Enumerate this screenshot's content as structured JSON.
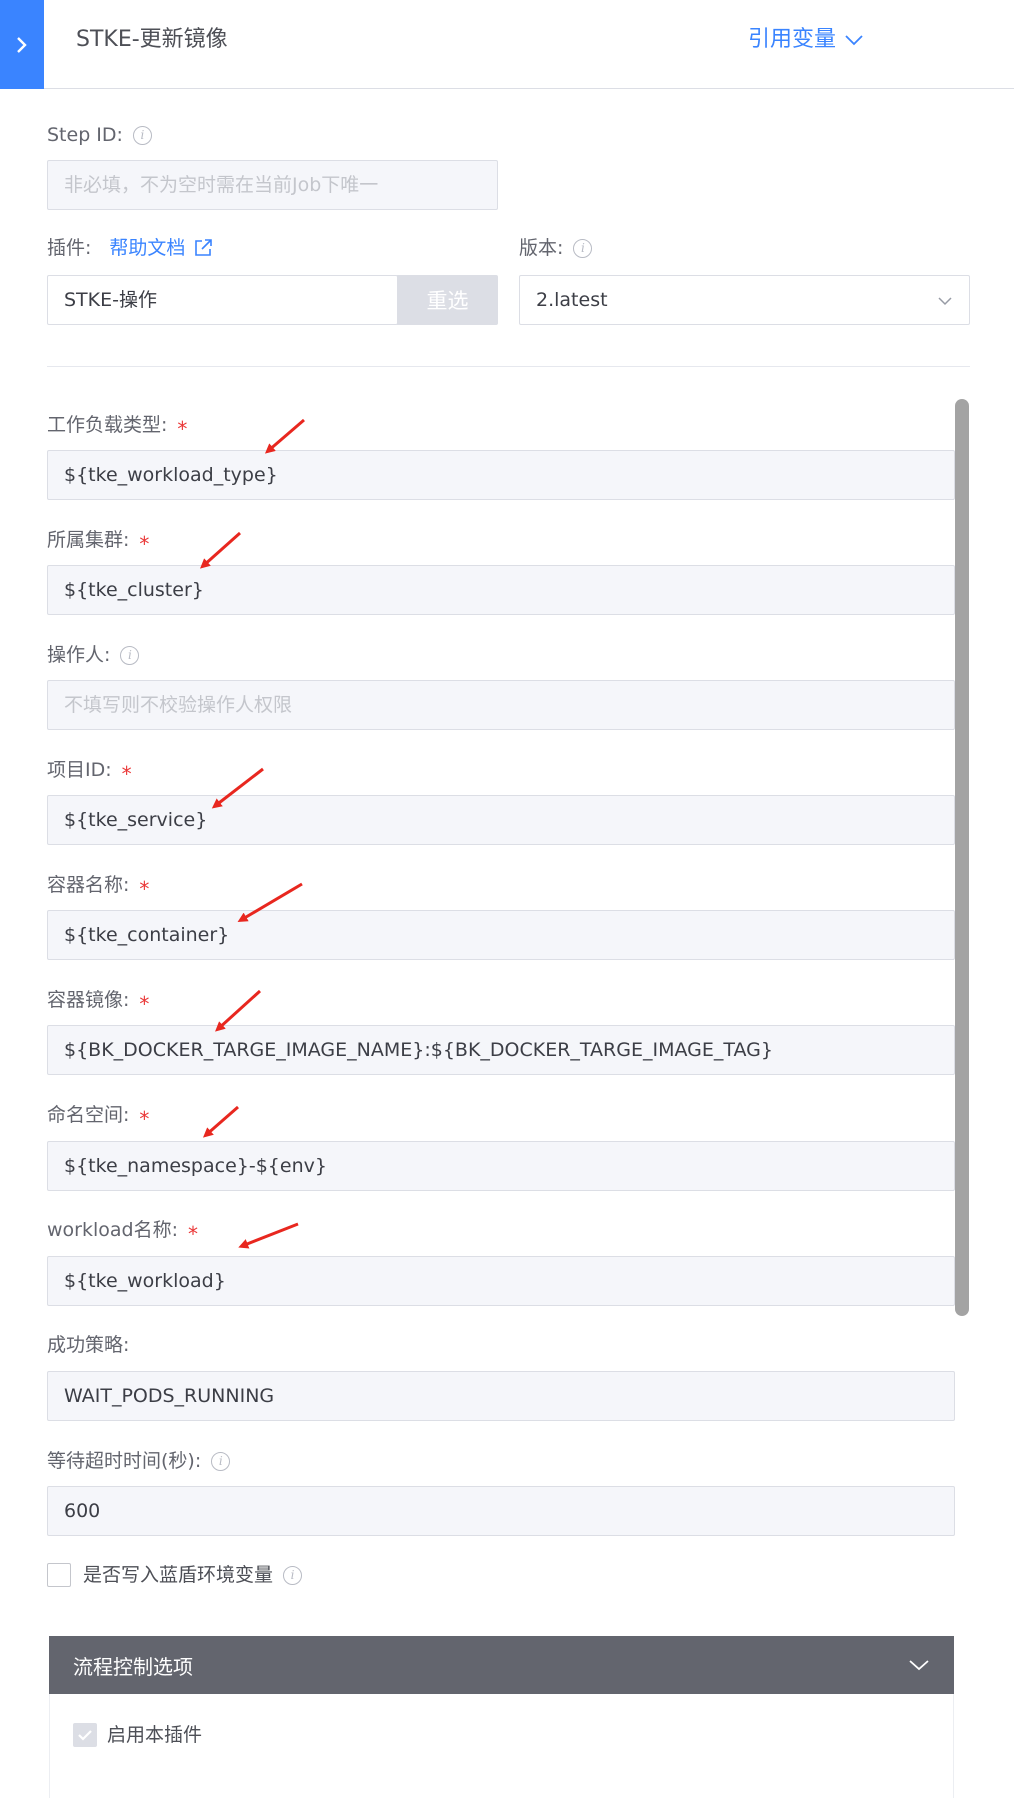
{
  "header": {
    "title": "STKE-更新镜像",
    "ref_var": "引用变量",
    "toggle_icon": "chevron-right-icon",
    "ref_var_icon": "chevron-down-icon"
  },
  "step_id": {
    "label": "Step ID:",
    "placeholder": "非必填，不为空时需在当前Job下唯一"
  },
  "plugin": {
    "label": "插件:",
    "help_link": "帮助文档",
    "value": "STKE-操作",
    "reselect": "重选"
  },
  "version": {
    "label": "版本:",
    "value": "2.latest"
  },
  "fields": [
    {
      "label": "工作负载类型:",
      "required": "*",
      "value": "${tke_workload_type}"
    },
    {
      "label": "所属集群:",
      "required": "*",
      "value": "${tke_cluster}"
    },
    {
      "label": "操作人:",
      "placeholder": "不填写则不校验操作人权限"
    },
    {
      "label": "项目ID:",
      "required": "*",
      "value": "${tke_service}"
    },
    {
      "label": "容器名称:",
      "required": "*",
      "value": "${tke_container}"
    },
    {
      "label": "容器镜像:",
      "required": "*",
      "value": "${BK_DOCKER_TARGE_IMAGE_NAME}:${BK_DOCKER_TARGE_IMAGE_TAG}"
    },
    {
      "label": "命名空间:",
      "required": "*",
      "value": "${tke_namespace}-${env}"
    },
    {
      "label": "workload名称:",
      "required": "*",
      "value": "${tke_workload}"
    },
    {
      "label": "成功策略:",
      "value": "WAIT_PODS_RUNNING"
    },
    {
      "label": "等待超时时间(秒):",
      "value": "600"
    }
  ],
  "bluewhale_env": {
    "label": "是否写入蓝盾环境变量"
  },
  "flow_control": {
    "title": "流程控制选项",
    "enable_plugin": "启用本插件"
  },
  "colors": {
    "accent": "#3a84ff",
    "required": "#ea3636",
    "annotation_arrow": "#e8271f",
    "panel_header": "#63656e"
  }
}
